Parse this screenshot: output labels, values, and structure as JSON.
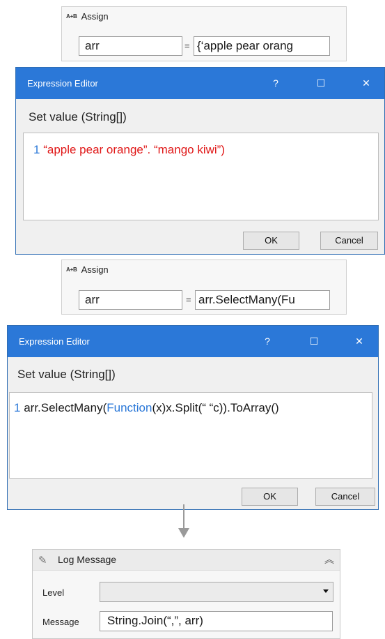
{
  "assign1": {
    "icon": "A+B",
    "title": "Assign",
    "to": "arr",
    "equals": "=",
    "value": "{‘apple pear orang"
  },
  "editor1": {
    "title": "Expression Editor",
    "help": "?",
    "maximize": "☐",
    "close": "✕",
    "subtitle": "Set value (String[])",
    "line_number": "1",
    "code": "“apple pear orange”. “mango kiwi”)",
    "ok": "OK",
    "cancel": "Cancel"
  },
  "assign2": {
    "icon": "A+B",
    "title": "Assign",
    "to": "arr",
    "equals": "=",
    "value": "arr.SelectMany(Fu"
  },
  "editor2": {
    "title": "Expression Editor",
    "help": "?",
    "maximize": "☐",
    "close": "✕",
    "subtitle": "Set value (String[])",
    "line_number": "1",
    "code_part1": "arr.SelectMany(",
    "code_keyword": "Function",
    "code_part2": "(x)x.Split(“ “c)).ToArray()",
    "ok": "OK",
    "cancel": "Cancel"
  },
  "log_message": {
    "title": "Log Message",
    "level_label": "Level",
    "level_value": "",
    "message_label": "Message",
    "message_value": "String.Join(“,”, arr)"
  },
  "colors": {
    "title_bar": "#2b78d8",
    "string_literal": "#e01818",
    "keyword": "#2b78d8"
  }
}
